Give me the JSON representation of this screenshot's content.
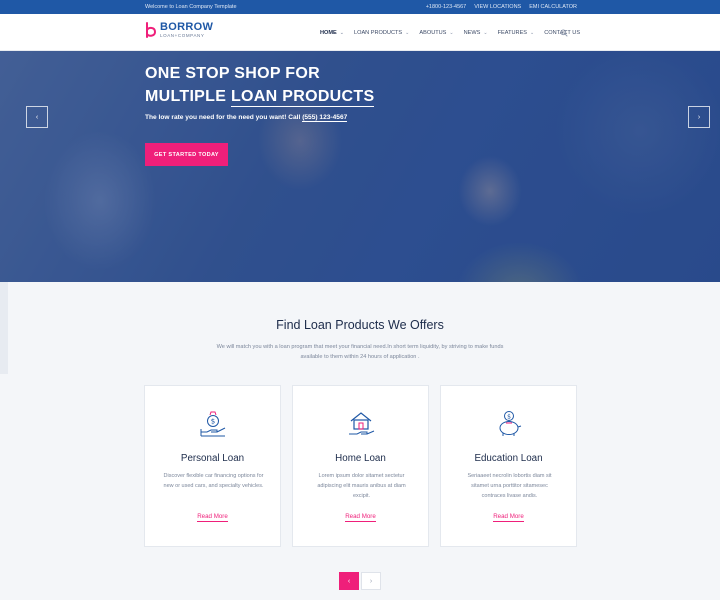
{
  "topbar": {
    "welcome": "Welcome to Loan Company Template",
    "phone": "+1800-123-4567",
    "locations": "VIEW LOCATIONS",
    "calculator": "EMI CALCULATOR"
  },
  "brand": {
    "name": "BORROW",
    "sub": "LOAN+COMPANY",
    "primary": "#1f58a6",
    "accent": "#ef1f7a"
  },
  "nav": {
    "items": [
      {
        "label": "HOME",
        "dropdown": true
      },
      {
        "label": "LOAN PRODUCTS",
        "dropdown": true
      },
      {
        "label": "ABOUTUS",
        "dropdown": true
      },
      {
        "label": "NEWS",
        "dropdown": true
      },
      {
        "label": "FEATURES",
        "dropdown": true
      },
      {
        "label": "CONTACT US",
        "dropdown": false
      }
    ]
  },
  "hero": {
    "line1": "ONE STOP SHOP FOR",
    "line2_prefix": "MULTIPLE",
    "line2_highlight": "LOAN PRODUCTS",
    "sub": "The low rate you need for the need you want! Call",
    "phone": "(555) 123-4567",
    "cta": "GET STARTED TODAY",
    "prev": "‹",
    "next": "›"
  },
  "offers": {
    "title": "Find Loan Products We Offers",
    "desc": "We will match you with a loan program that meet your financial need.In short term liquidity, by striving to make funds available to them within 24 hours of application .",
    "cards": [
      {
        "title": "Personal Loan",
        "text": "Discover flexible car financing options for new or used cars, and specialty vehicles.",
        "link": "Read More",
        "icon": "money-bag-hand-icon"
      },
      {
        "title": "Home Loan",
        "text": "Lorem ipsum dolor sitamet sectetur adipiscing elit mauris anibus at diam excipit.",
        "link": "Read More",
        "icon": "house-hand-icon"
      },
      {
        "title": "Education Loan",
        "text": "Seriaaeet necrolin lobortis diam sit sitamet urna porttitor sitamesec contraces livase andis.",
        "link": "Read More",
        "icon": "piggy-bank-icon"
      }
    ]
  },
  "pager": {
    "prev": "‹",
    "next": "›"
  }
}
